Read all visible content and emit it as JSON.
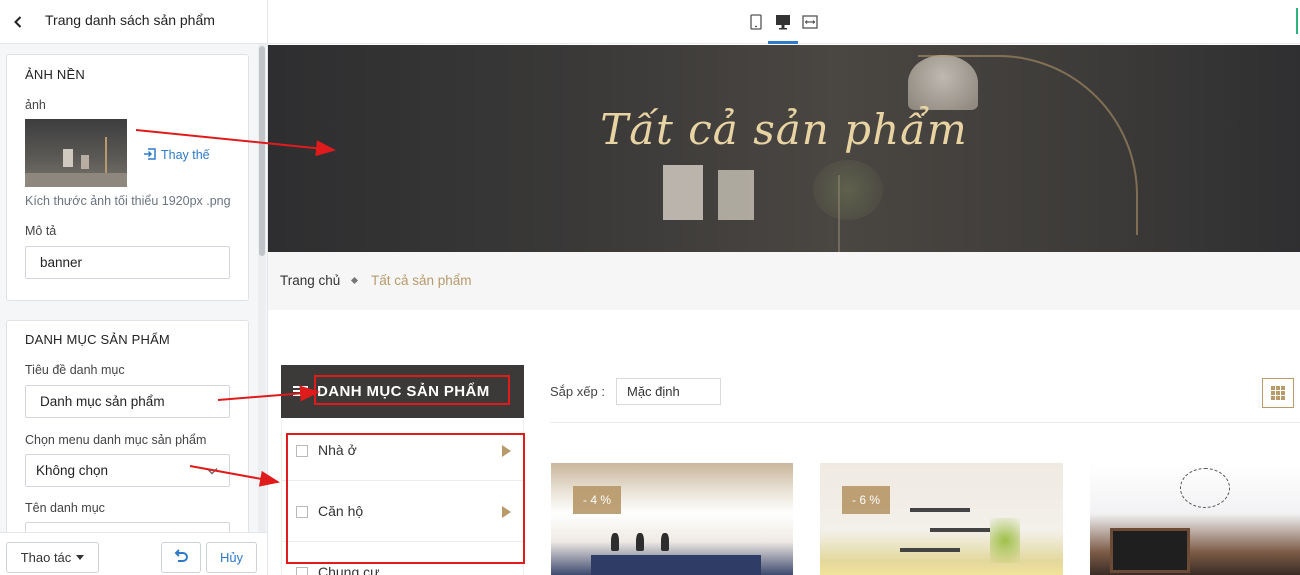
{
  "sidebar": {
    "title": "Trang danh sách sản phẩm",
    "background_section": {
      "title": "ẢNH NỀN",
      "image_label": "ảnh",
      "replace_label": "Thay thế",
      "hint": "Kích thước ảnh tối thiểu 1920px .png",
      "desc_label": "Mô tả",
      "desc_value": "banner"
    },
    "category_section": {
      "title": "DANH MỤC SẢN PHẨM",
      "title_label": "Tiêu đề danh mục",
      "title_value": "Danh mục sản phẩm",
      "menu_label": "Chọn menu danh mục sản phẩm",
      "menu_value": "Không chọn",
      "name_label": "Tên danh mục"
    },
    "footer": {
      "actions_label": "Thao tác",
      "cancel_label": "Hủy"
    }
  },
  "preview": {
    "banner_title": "Tất cả sản phẩm",
    "breadcrumb": {
      "home": "Trang chủ",
      "current": "Tất cả sản phẩm"
    },
    "category_block": {
      "title": "DANH MỤC SẢN PHẨM",
      "items": [
        {
          "label": "Nhà ở"
        },
        {
          "label": "Căn hộ"
        },
        {
          "label": "Chung cư"
        }
      ]
    },
    "sort": {
      "label": "Sắp xếp :",
      "value": "Mặc định"
    },
    "products": [
      {
        "discount": "- 4 %"
      },
      {
        "discount": "- 6 %"
      },
      {
        "discount": ""
      }
    ]
  },
  "icons": {
    "back": "chevron-left-icon",
    "replace": "replace-image-icon",
    "select": "chevron-down-icon",
    "undo": "undo-icon",
    "devices": [
      "mobile-icon",
      "desktop-icon",
      "fullwidth-icon"
    ],
    "menu": "hamburger-icon",
    "grid": "grid-view-icon"
  },
  "colors": {
    "accent": "#2f7bc9",
    "gold": "#b89a6b",
    "annotation": "#e01b1b",
    "category_header": "#3b3a39"
  }
}
